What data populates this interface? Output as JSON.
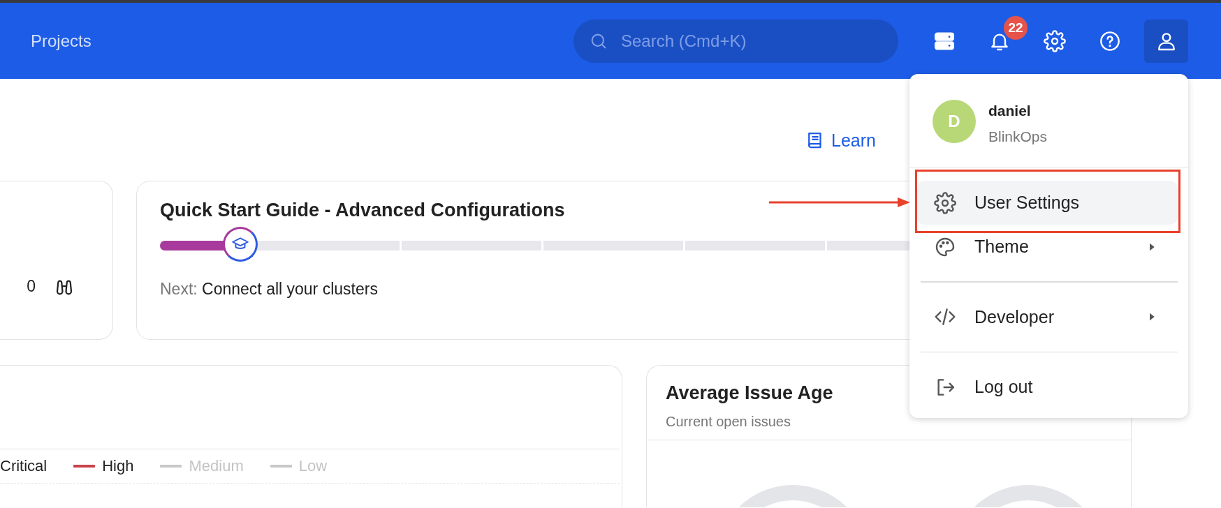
{
  "header": {
    "title": "Projects",
    "search": {
      "placeholder": "Search (Cmd+K)"
    },
    "notifications": {
      "count": "22"
    }
  },
  "learn_link": {
    "label": "Learn"
  },
  "summary_card": {
    "value": "0"
  },
  "quick_start": {
    "title": "Quick Start Guide - Advanced Configurations",
    "level": 0.085,
    "next_label": "Next:",
    "next_step": "Connect all your clusters"
  },
  "severity_card": {
    "legend": [
      {
        "label": "Critical",
        "active": true
      },
      {
        "label": "High",
        "active": true,
        "color": "#c9424a"
      },
      {
        "label": "Medium",
        "active": false
      },
      {
        "label": "Low",
        "active": false
      }
    ]
  },
  "issue_age": {
    "title": "Average Issue Age",
    "subtitle": "Current open issues",
    "rings": [
      {
        "kind": "ring"
      },
      {
        "kind": "ring"
      }
    ]
  },
  "user_menu": {
    "open": true,
    "user": {
      "initial": "D",
      "name": "daniel",
      "org": "BlinkOps"
    },
    "items": [
      {
        "kind": "item",
        "label": "User Settings",
        "selected": true,
        "submenu": false,
        "outlined": true
      },
      {
        "kind": "item",
        "label": "Theme",
        "selected": false,
        "submenu": true
      },
      {
        "kind": "divider"
      },
      {
        "kind": "item",
        "label": "Developer",
        "selected": false,
        "submenu": true
      },
      {
        "kind": "divider"
      },
      {
        "kind": "item",
        "label": "Log out",
        "selected": false,
        "submenu": false
      }
    ]
  },
  "annotations": [
    {
      "kind": "arrow"
    }
  ]
}
